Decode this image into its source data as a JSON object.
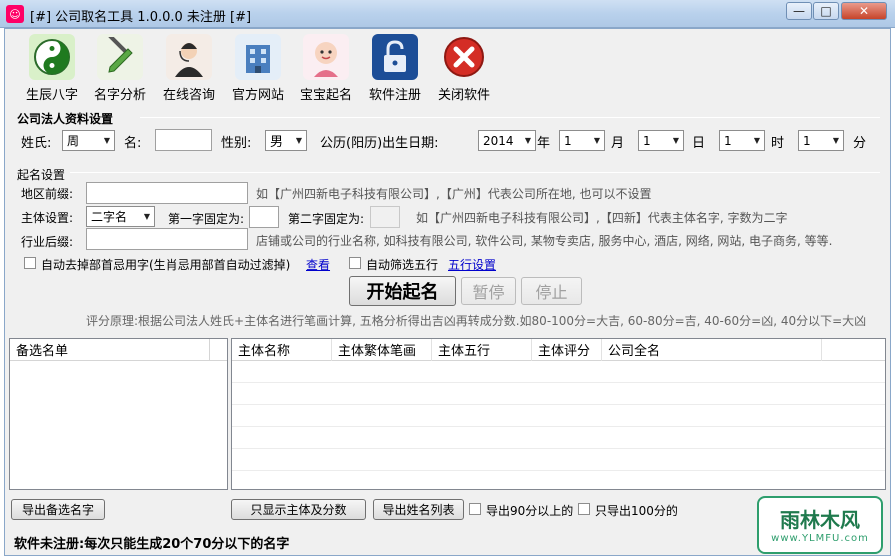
{
  "window": {
    "title": "[#] 公司取名工具 1.0.0.0 未注册 [#]",
    "min_label": "—",
    "max_label": "□",
    "close_label": "✕"
  },
  "toolbar": [
    {
      "label": "生辰八字",
      "icon": "taiji-icon"
    },
    {
      "label": "名字分析",
      "icon": "pencil-ruler-icon"
    },
    {
      "label": "在线咨询",
      "icon": "operator-icon"
    },
    {
      "label": "官方网站",
      "icon": "building-icon"
    },
    {
      "label": "宝宝起名",
      "icon": "baby-icon"
    },
    {
      "label": "软件注册",
      "icon": "lock-icon"
    },
    {
      "label": "关闭软件",
      "icon": "close-icon"
    }
  ],
  "legal": {
    "section_title": "公司法人资料设置",
    "surname_label": "姓氏:",
    "surname_value": "周",
    "name_label": "名:",
    "name_value": "",
    "gender_label": "性别:",
    "gender_value": "男",
    "birth_label": "公历(阳历)出生日期:",
    "year_value": "2014",
    "year_unit": "年",
    "month_value": "1",
    "month_unit": "月",
    "day_value": "1",
    "day_unit": "日",
    "hour_value": "1",
    "hour_unit": "时",
    "minute_value": "1",
    "minute_unit": "分"
  },
  "naming": {
    "section_title": "起名设置",
    "region_label": "地区前缀:",
    "region_value": "",
    "region_hint": "如【广州四新电子科技有限公司】,【广州】代表公司所在地, 也可以不设置",
    "subject_label": "主体设置:",
    "subject_value": "二字名",
    "first_fixed_label": "第一字固定为:",
    "first_fixed_value": "",
    "second_fixed_label": "第二字固定为:",
    "second_fixed_value": "",
    "subject_hint": "如【广州四新电子科技有限公司】,【四新】代表主体名字, 字数为二字",
    "industry_label": "行业后缀:",
    "industry_value": "",
    "industry_hint": "店铺或公司的行业名称, 如科技有限公司, 软件公司, 某物专卖店, 服务中心, 酒店, 网络, 网站, 电子商务, 等等.",
    "auto_remove_label": "自动去掉部首忌用字(生肖忌用部首自动过滤掉)",
    "view_link": "查看",
    "auto_filter_label": "自动筛选五行",
    "wuxing_link": "五行设置",
    "start_button": "开始起名",
    "pause_button": "暂停",
    "stop_button": "停止",
    "score_note": "评分原理:根据公司法人姓氏+主体名进行笔画计算, 五格分析得出吉凶再转成分数.如80-100分=大吉, 60-80分=吉, 40-60分=凶, 40分以下=大凶"
  },
  "candidates": {
    "header": "备选名单",
    "items": []
  },
  "results": {
    "columns": [
      "主体名称",
      "主体繁体笔画",
      "主体五行",
      "主体评分",
      "公司全名"
    ],
    "rows": []
  },
  "bottom": {
    "export_candidates": "导出备选名字",
    "show_subject_score": "只显示主体及分数",
    "export_list": "导出姓名列表",
    "export_90_label": "导出90分以上的",
    "export_100_label": "只导出100分的"
  },
  "status": {
    "text": "软件未注册:每次只能生成20个70分以下的名字"
  },
  "watermark": {
    "brand": "雨林木风",
    "url": "www.YLMFU.com"
  }
}
